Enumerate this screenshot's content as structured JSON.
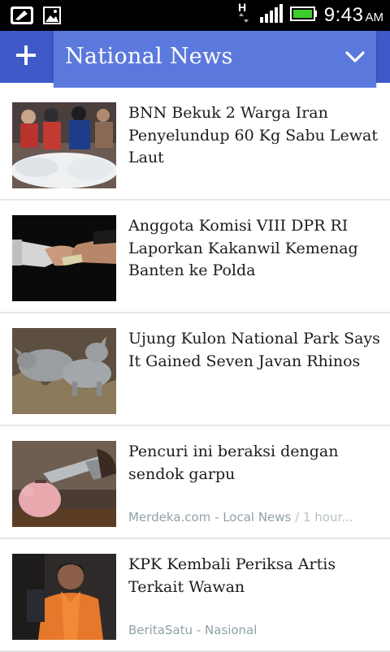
{
  "status_bar": {
    "time": "9:43",
    "ampm": "AM",
    "network_type": "H",
    "icons": [
      "whatsapp-icon",
      "gallery-icon",
      "network-h-icon",
      "signal-icon",
      "battery-icon"
    ]
  },
  "action_bar": {
    "add_icon": "plus-icon",
    "title": "National News",
    "dropdown_icon": "chevron-down-icon",
    "colors": {
      "bar": "#3f59c9",
      "title_box": "#5b79dd"
    }
  },
  "feed": {
    "items": [
      {
        "headline": "BNN Bekuk 2 Warga Iran Penyelundup 60 Kg Sabu Lewat Laut",
        "source": "",
        "time": ""
      },
      {
        "headline": "Anggota Komisi VIII DPR RI Laporkan Kakanwil Kemenag Banten ke Polda",
        "source": "",
        "time": ""
      },
      {
        "headline": "Ujung Kulon National Park Says It Gained Seven Javan Rhinos",
        "source": "",
        "time": ""
      },
      {
        "headline": "Pencuri ini beraksi dengan sendok garpu",
        "source": "Merdeka.com - Local News",
        "time": " / 1 hour..."
      },
      {
        "headline": "KPK Kembali Periksa Artis Terkait Wawan",
        "source": "BeritaSatu - Nasional",
        "time": ""
      }
    ]
  }
}
